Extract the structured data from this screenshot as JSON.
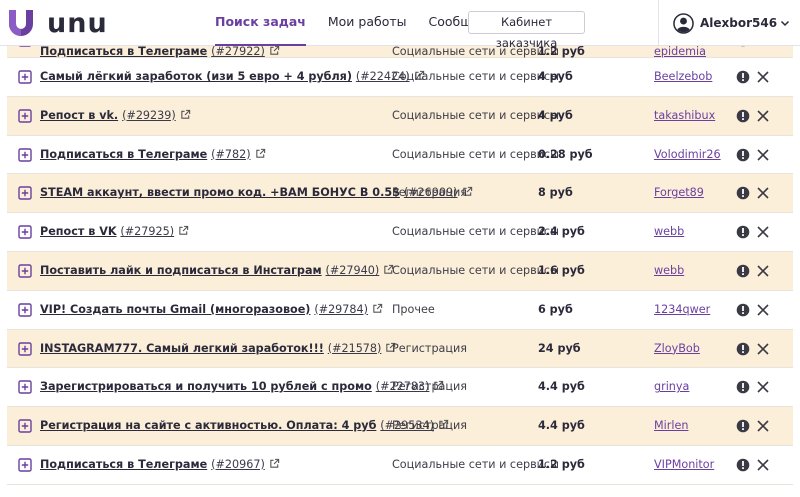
{
  "logo": {
    "text": "unu"
  },
  "nav": [
    {
      "label": "Поиск задач",
      "active": true
    },
    {
      "label": "Мои работы",
      "active": false
    },
    {
      "label": "Сообщения",
      "active": false
    }
  ],
  "cabinet_button": "Кабинет заказчика",
  "user": {
    "name": "Alexbor546"
  },
  "colors": {
    "accent": "#6a3fa0",
    "row_highlight": "#fcefd9",
    "text": "#2b2a3a"
  },
  "tasks": [
    {
      "title": "Подписаться в Телеграме",
      "id": "(#27922)",
      "category": "Социальные сети и сервисы",
      "price": "1.2 руб",
      "author": "epidemia"
    },
    {
      "title": "Самый лёгкий заработок (изи 5 евро + 4 рубля)",
      "id": "(#22424)",
      "category": "Социальные сети и сервисы",
      "price": "4 руб",
      "author": "Beelzebob"
    },
    {
      "title": "Репост в vk.",
      "id": "(#29239)",
      "category": "Социальные сети и сервисы",
      "price": "4 руб",
      "author": "takashibux"
    },
    {
      "title": "Подписаться в Телеграме",
      "id": "(#782)",
      "category": "Социальные сети и сервисы",
      "price": "0.28 руб",
      "author": "Volodimir26"
    },
    {
      "title": "STEAM аккаунт, ввести промо код. +ВАМ БОНУС В 0.5$",
      "id": "(#26909)",
      "category": "Регистрация",
      "price": "8 руб",
      "author": "Forget89"
    },
    {
      "title": "Репост в VK",
      "id": "(#27925)",
      "category": "Социальные сети и сервисы",
      "price": "2.4 руб",
      "author": "webb"
    },
    {
      "title": "Поставить лайк и подписаться в Инстаграм",
      "id": "(#27940)",
      "category": "Социальные сети и сервисы",
      "price": "1.6 руб",
      "author": "webb"
    },
    {
      "title": "VIP! Создать почты Gmail (многоразовое)",
      "id": "(#29784)",
      "category": "Прочее",
      "price": "6 руб",
      "author": "1234qwer"
    },
    {
      "title": "INSTAGRAM777. Самый легкий заработок!!!",
      "id": "(#21578)",
      "category": "Регистрация",
      "price": "24 руб",
      "author": "ZloyBob"
    },
    {
      "title": "Зарегистрироваться и получить 10 рублей с промо",
      "id": "(#22783)",
      "category": "Регистрация",
      "price": "4.4 руб",
      "author": "grinya"
    },
    {
      "title": "Регистрация на сайте с активностью. Оплата: 4 руб",
      "id": "(#29534)",
      "category": "Регистрация",
      "price": "4.4 руб",
      "author": "Mirlen"
    },
    {
      "title": "Подписаться в Телеграме",
      "id": "(#20967)",
      "category": "Социальные сети и сервисы",
      "price": "1.2 руб",
      "author": "VIPMonitor"
    }
  ]
}
